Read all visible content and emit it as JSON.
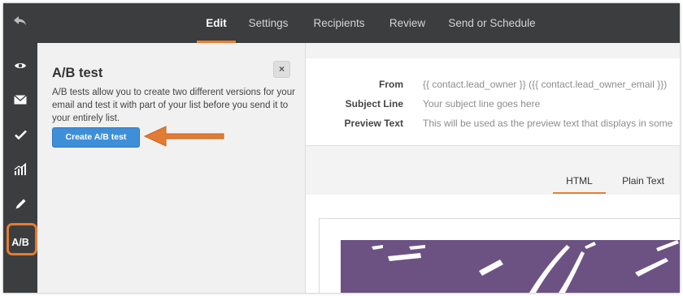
{
  "nav": {
    "tabs": [
      {
        "label": "Edit",
        "active": true
      },
      {
        "label": "Settings",
        "active": false
      },
      {
        "label": "Recipients",
        "active": false
      },
      {
        "label": "Review",
        "active": false
      },
      {
        "label": "Send or Schedule",
        "active": false
      }
    ]
  },
  "rail": {
    "items": [
      {
        "icon": "eye-icon"
      },
      {
        "icon": "envelope-icon"
      },
      {
        "icon": "checkmark-icon"
      },
      {
        "icon": "bar-chart-icon"
      },
      {
        "icon": "pencil-icon"
      },
      {
        "label": "A/B",
        "active": true
      }
    ]
  },
  "ab_panel": {
    "title": "A/B test",
    "description": "A/B tests allow you to create two different versions for your email and test it with part of your list before you send it to your entirely list.",
    "close": "×",
    "create_button": "Create A/B test"
  },
  "details": {
    "from_label": "From",
    "from_value": "{{ contact.lead_owner }} ({{ contact.lead_owner_email }})",
    "subject_label": "Subject Line",
    "subject_value": "Your subject line goes here",
    "preview_label": "Preview Text",
    "preview_value": "This will be used as the preview text that displays in some"
  },
  "view_tabs": [
    {
      "label": "HTML",
      "active": true
    },
    {
      "label": "Plain Text",
      "active": false
    }
  ],
  "colors": {
    "accent": "#ea7e2f",
    "topbar": "#3c3d3f",
    "button": "#3f8fd8",
    "hero": "#6c5283"
  }
}
